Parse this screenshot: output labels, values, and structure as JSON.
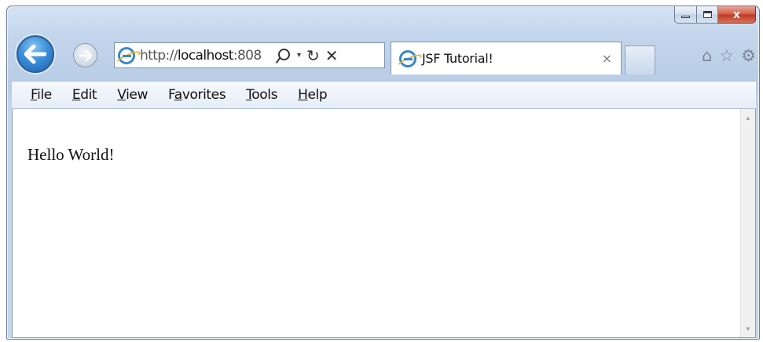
{
  "window": {
    "caption_buttons": {
      "minimize": "minimize-icon",
      "maximize": "maximize-icon",
      "close": "x"
    }
  },
  "navigation": {
    "back_icon": "back-arrow-icon",
    "forward_icon": "forward-arrow-icon"
  },
  "address_bar": {
    "url_prefix": "http://",
    "url_host": "localhost",
    "url_rest": ":808",
    "icons": [
      "search-icon",
      "dropdown-icon",
      "refresh-icon",
      "stop-icon"
    ]
  },
  "tab": {
    "title": "JSF Tutorial!",
    "close": "×"
  },
  "toolbar_icons": [
    "home-icon",
    "favorites-star-icon",
    "settings-gear-icon"
  ],
  "menu": {
    "items": [
      {
        "label": "File",
        "accel": "F",
        "rest": "ile"
      },
      {
        "label": "Edit",
        "accel": "E",
        "rest": "dit"
      },
      {
        "label": "View",
        "accel": "V",
        "rest": "iew"
      },
      {
        "label": "Favorites",
        "pre": "F",
        "accel": "a",
        "rest": "vorites"
      },
      {
        "label": "Tools",
        "accel": "T",
        "rest": "ools"
      },
      {
        "label": "Help",
        "accel": "H",
        "rest": "elp"
      }
    ]
  },
  "page": {
    "text": "Hello World!"
  }
}
